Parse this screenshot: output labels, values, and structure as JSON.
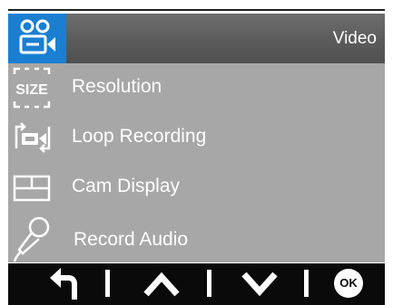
{
  "header": {
    "title": "Video",
    "icon": "video-camera-icon",
    "accent_color": "#1a7fd1"
  },
  "menu": {
    "items": [
      {
        "label": "Resolution",
        "icon": "size-icon"
      },
      {
        "label": "Loop Recording",
        "icon": "loop-recording-icon"
      },
      {
        "label": "Cam Display",
        "icon": "cam-display-icon"
      },
      {
        "label": "Record Audio",
        "icon": "microphone-icon"
      }
    ]
  },
  "size_icon_text": "SIZE",
  "bottom_bar": {
    "buttons": [
      {
        "name": "back",
        "icon": "back-arrow-icon"
      },
      {
        "name": "up",
        "icon": "chevron-up-icon"
      },
      {
        "name": "down",
        "icon": "chevron-down-icon"
      },
      {
        "name": "ok",
        "icon": "ok-icon",
        "label": "OK"
      }
    ]
  }
}
